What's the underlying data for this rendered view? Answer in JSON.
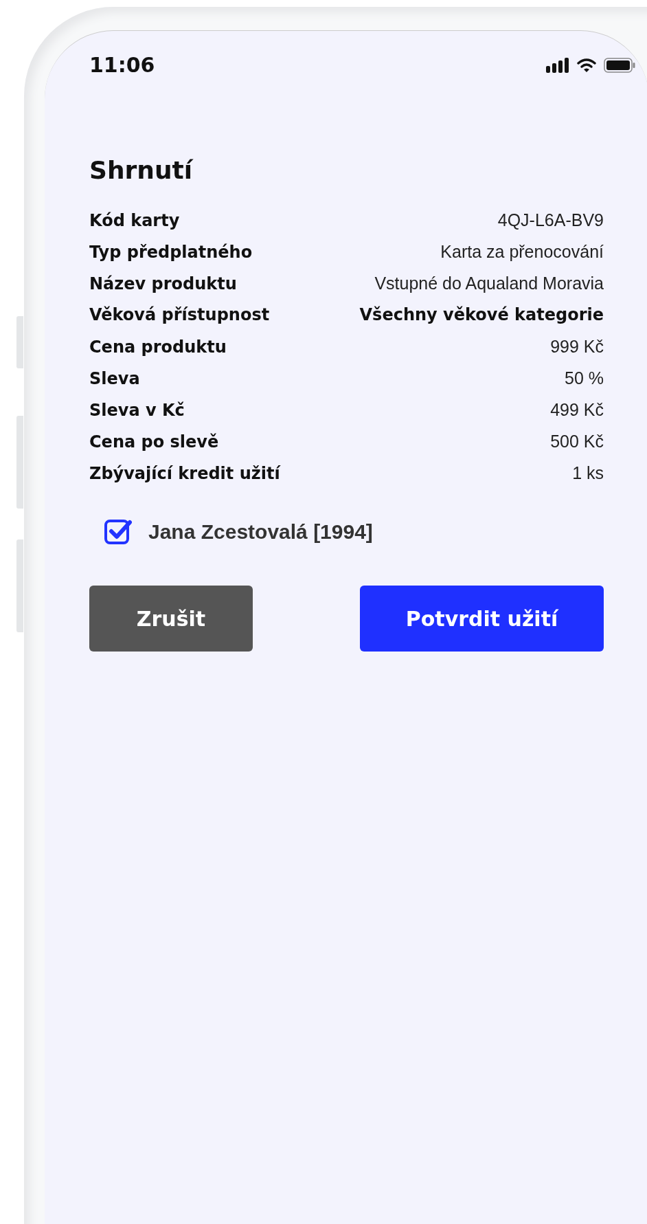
{
  "status_bar": {
    "time": "11:06"
  },
  "title": "Shrnutí",
  "rows": [
    {
      "label": "Kód karty",
      "value": "4QJ-L6A-BV9",
      "emphasized": false
    },
    {
      "label": "Typ předplatného",
      "value": "Karta za přenocování",
      "emphasized": false
    },
    {
      "label": "Název produktu",
      "value": "Vstupné do Aqualand Moravia",
      "emphasized": false
    },
    {
      "label": "Věková přístupnost",
      "value": "Všechny věkové kategorie",
      "emphasized": true
    },
    {
      "label": "Cena produktu",
      "value": "999 Kč",
      "emphasized": false
    },
    {
      "label": "Sleva",
      "value": "50 %",
      "emphasized": false
    },
    {
      "label": "Sleva v Kč",
      "value": "499 Kč",
      "emphasized": false
    },
    {
      "label": "Cena po slevě",
      "value": "500 Kč",
      "emphasized": false
    },
    {
      "label": "Zbývající kredit užití",
      "value": "1 ks",
      "emphasized": false
    }
  ],
  "persons": [
    {
      "label": "Jana Zcestovalá [1994]",
      "checked": true
    }
  ],
  "buttons": [
    {
      "label": "Zrušit",
      "kind": "secondary"
    },
    {
      "label": "Potvrdit užití",
      "kind": "primary"
    }
  ]
}
